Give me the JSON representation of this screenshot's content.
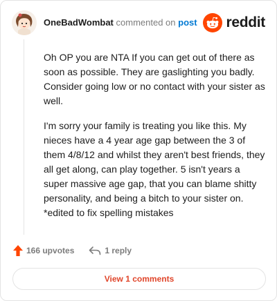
{
  "header": {
    "username": "OneBadWombat",
    "action_text": "commented on",
    "target_link": "post"
  },
  "logo": {
    "text": "reddit",
    "icon": "reddit-alien-icon",
    "color": "#ff4500"
  },
  "comment": {
    "paragraphs": [
      "Oh OP you are NTA If you can get out of there as soon as possible. They are gaslighting you badly. Consider going low or no contact with your sister as well.",
      "I'm sorry your family is treating you like this. My nieces have a 4 year age gap between the 3 of them 4/8/12 and whilst they aren't best friends, they all get along, can play together. 5 isn't years a super massive age gap, that you can blame shitty personality, and being a bitch to your sister on. *edited to fix spelling mistakes"
    ]
  },
  "actions": {
    "upvotes_label": "166 upvotes",
    "upvote_icon": "upvote-arrow-icon",
    "upvote_color": "#ff4500",
    "reply_label": "1 reply",
    "reply_icon": "reply-arrow-icon"
  },
  "view_comments": {
    "label": "View 1 comments",
    "color": "#e0452a"
  },
  "avatar": {
    "icon": "cartoon-avatar"
  }
}
